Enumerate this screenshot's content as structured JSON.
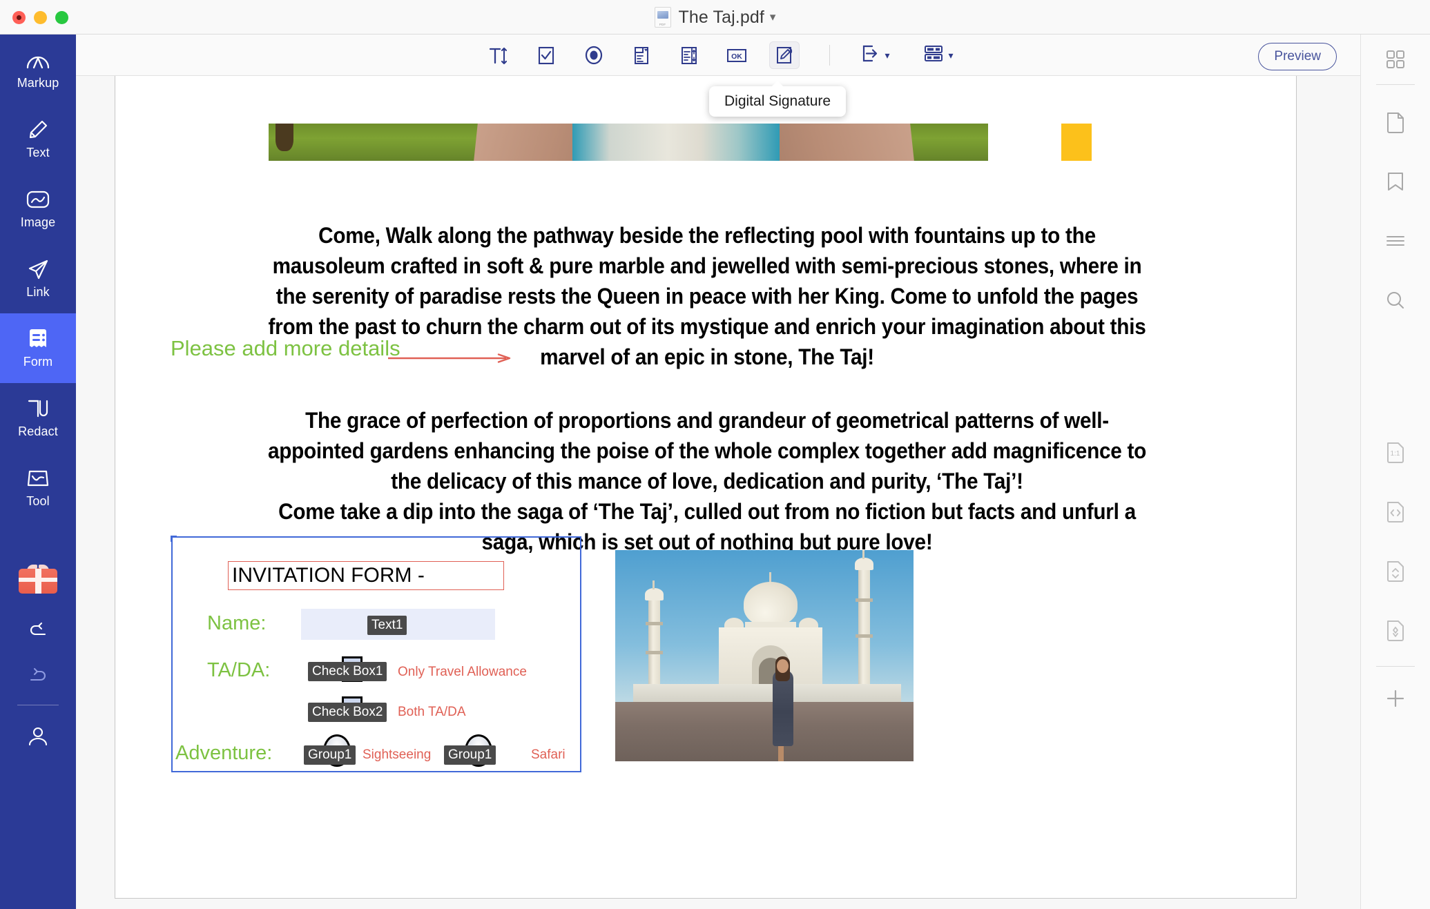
{
  "window": {
    "title": "The Taj.pdf",
    "title_chevron": "chevron-down",
    "traffic_lights": [
      "close",
      "minimize",
      "maximize"
    ]
  },
  "sidebar": {
    "items": [
      {
        "label": "Markup",
        "icon": "markup-icon",
        "active": false
      },
      {
        "label": "Text",
        "icon": "pencil-icon",
        "active": false
      },
      {
        "label": "Image",
        "icon": "image-icon",
        "active": false
      },
      {
        "label": "Link",
        "icon": "link-send-icon",
        "active": false
      },
      {
        "label": "Form",
        "icon": "form-icon",
        "active": true
      },
      {
        "label": "Redact",
        "icon": "redact-icon",
        "active": false
      },
      {
        "label": "Tool",
        "icon": "tool-icon",
        "active": false
      }
    ],
    "gift_label": "gift-icon",
    "undo_label": "undo-icon",
    "redo_label": "redo-icon",
    "account_label": "account-icon"
  },
  "toolbar": {
    "buttons": [
      {
        "name": "text-field-tool",
        "icon": "text-height-icon",
        "selected": false
      },
      {
        "name": "checkbox-tool",
        "icon": "checkbox-icon",
        "selected": false
      },
      {
        "name": "radio-button-tool",
        "icon": "radio-button-icon",
        "selected": false
      },
      {
        "name": "combo-box-tool",
        "icon": "combo-box-icon",
        "selected": false
      },
      {
        "name": "list-box-tool",
        "icon": "list-box-icon",
        "selected": false
      },
      {
        "name": "push-button-tool",
        "icon": "ok-button-icon",
        "selected": false
      },
      {
        "name": "digital-signature-tool",
        "icon": "signature-icon",
        "selected": true
      }
    ],
    "import_icon": "import-form-data-icon",
    "more_icon": "form-settings-icon",
    "preview_label": "Preview"
  },
  "tooltip": {
    "text": "Digital Signature"
  },
  "rightbar": {
    "items": [
      {
        "name": "thumbnails-grid",
        "icon": "grid-icon"
      },
      {
        "name": "page-view",
        "icon": "page-icon"
      },
      {
        "name": "bookmarks",
        "icon": "bookmark-icon"
      },
      {
        "name": "outline",
        "icon": "list-lines-icon"
      },
      {
        "name": "search",
        "icon": "search-icon"
      },
      {
        "name": "actual-size",
        "icon": "one-to-one-icon"
      },
      {
        "name": "fit-width",
        "icon": "fit-width-icon"
      },
      {
        "name": "fit-height",
        "icon": "fit-height-icon"
      },
      {
        "name": "fit-page",
        "icon": "fit-page-icon"
      },
      {
        "name": "zoom-in",
        "icon": "plus-icon"
      }
    ]
  },
  "document": {
    "banner_alt": "reflecting-pool-pathway-banner",
    "paragraphs": [
      "Come, Walk along the pathway beside the reflecting pool with fountains up to the mausoleum crafted in soft & pure marble and jewelled with semi-precious stones, where in the serenity of paradise rests the Queen in peace with her King. Come to unfold the pages from the past to churn the charm out of its mystique and enrich your imagination about this marvel of an epic in stone, The Taj!",
      "The grace of perfection of proportions and grandeur of geometrical patterns of well-appointed gardens enhancing the poise of the whole complex together add magnificence to the delicacy of this mance of love, dedication and purity, ‘The Taj’!",
      "Come take a dip into the saga of ‘The Taj’, culled out from no fiction but facts and unfurl a saga, which is set out of nothing but pure love!"
    ],
    "annotation": {
      "text": "Please add more details",
      "color": "#7dc242",
      "arrow_color": "#e06055"
    },
    "photo_alt": "taj-mahal-with-woman-photo"
  },
  "form": {
    "title": "INVITATION FORM -",
    "fields": [
      {
        "label": "Name:",
        "widget": "Text1",
        "type": "text"
      },
      {
        "label": "TA/DA:",
        "widget": "Check Box1",
        "type": "checkbox",
        "description": "Only Travel Allowance"
      },
      {
        "label": "",
        "widget": "Check Box2",
        "type": "checkbox",
        "description": "Both TA/DA"
      },
      {
        "label": "Adventure:",
        "widget": "Group1",
        "type": "radio",
        "description": "Sightseeing"
      },
      {
        "label": "",
        "widget": "Group1",
        "type": "radio",
        "description": "Safari"
      }
    ],
    "border_color": "#4169d8",
    "title_border_color": "#e06055",
    "label_color": "#7dc242",
    "description_color": "#e06055"
  }
}
